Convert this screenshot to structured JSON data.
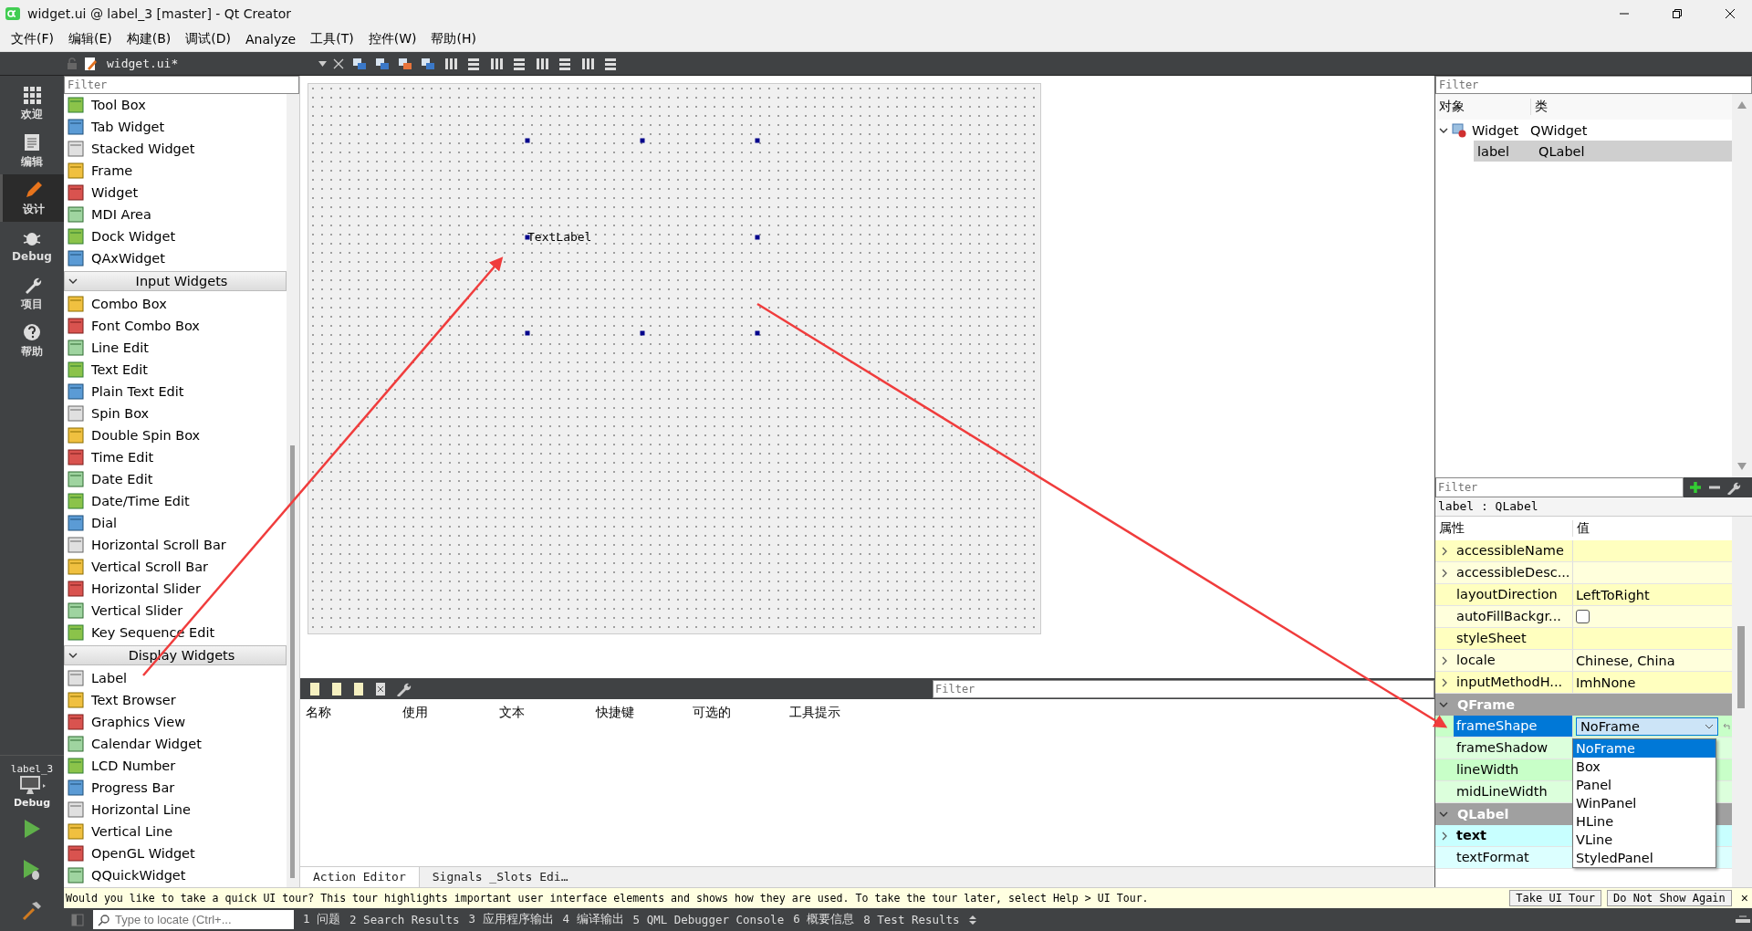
{
  "window": {
    "title": "widget.ui @ label_3 [master] - Qt Creator"
  },
  "menu": [
    "文件(F)",
    "编辑(E)",
    "构建(B)",
    "调试(D)",
    "Analyze",
    "工具(T)",
    "控件(W)",
    "帮助(H)"
  ],
  "editor_toolbar": {
    "document": "widget.ui*"
  },
  "mode_bar": [
    {
      "label": "欢迎",
      "kind": "welcome",
      "selected": false
    },
    {
      "label": "编辑",
      "kind": "edit",
      "selected": false
    },
    {
      "label": "设计",
      "kind": "design",
      "selected": true
    },
    {
      "label": "Debug",
      "kind": "debug",
      "selected": false
    },
    {
      "label": "项目",
      "kind": "projects",
      "selected": false
    },
    {
      "label": "帮助",
      "kind": "help",
      "selected": false
    }
  ],
  "kit_selector": {
    "project": "label_3",
    "build": "Debug"
  },
  "widget_box": {
    "placeholder": "Filter",
    "entries": [
      {
        "kind": "item",
        "label": "Tool Box"
      },
      {
        "kind": "item",
        "label": "Tab Widget"
      },
      {
        "kind": "item",
        "label": "Stacked Widget"
      },
      {
        "kind": "item",
        "label": "Frame"
      },
      {
        "kind": "item",
        "label": "Widget"
      },
      {
        "kind": "item",
        "label": "MDI Area"
      },
      {
        "kind": "item",
        "label": "Dock Widget"
      },
      {
        "kind": "item",
        "label": "QAxWidget"
      },
      {
        "kind": "category",
        "label": "Input Widgets",
        "expanded": true
      },
      {
        "kind": "item",
        "label": "Combo Box"
      },
      {
        "kind": "item",
        "label": "Font Combo Box"
      },
      {
        "kind": "item",
        "label": "Line Edit"
      },
      {
        "kind": "item",
        "label": "Text Edit"
      },
      {
        "kind": "item",
        "label": "Plain Text Edit"
      },
      {
        "kind": "item",
        "label": "Spin Box"
      },
      {
        "kind": "item",
        "label": "Double Spin Box"
      },
      {
        "kind": "item",
        "label": "Time Edit"
      },
      {
        "kind": "item",
        "label": "Date Edit"
      },
      {
        "kind": "item",
        "label": "Date/Time Edit"
      },
      {
        "kind": "item",
        "label": "Dial"
      },
      {
        "kind": "item",
        "label": "Horizontal Scroll Bar"
      },
      {
        "kind": "item",
        "label": "Vertical Scroll Bar"
      },
      {
        "kind": "item",
        "label": "Horizontal Slider"
      },
      {
        "kind": "item",
        "label": "Vertical Slider"
      },
      {
        "kind": "item",
        "label": "Key Sequence Edit"
      },
      {
        "kind": "category",
        "label": "Display Widgets",
        "expanded": true
      },
      {
        "kind": "item",
        "label": "Label"
      },
      {
        "kind": "item",
        "label": "Text Browser"
      },
      {
        "kind": "item",
        "label": "Graphics View"
      },
      {
        "kind": "item",
        "label": "Calendar Widget"
      },
      {
        "kind": "item",
        "label": "LCD Number"
      },
      {
        "kind": "item",
        "label": "Progress Bar"
      },
      {
        "kind": "item",
        "label": "Horizontal Line"
      },
      {
        "kind": "item",
        "label": "Vertical Line"
      },
      {
        "kind": "item",
        "label": "OpenGL Widget"
      },
      {
        "kind": "item",
        "label": "QQuickWidget"
      }
    ]
  },
  "form": {
    "label": {
      "text": "TextLabel",
      "selected": true
    }
  },
  "action_editor": {
    "placeholder": "Filter",
    "columns": [
      "名称",
      "使用",
      "文本",
      "快捷键",
      "可选的",
      "工具提示"
    ],
    "tabs": [
      {
        "label": "Action Editor",
        "selected": true
      },
      {
        "label": "Signals _Slots Edi…",
        "selected": false
      }
    ]
  },
  "object_inspector": {
    "placeholder": "Filter",
    "columns": [
      "对象",
      "类"
    ],
    "rows": [
      {
        "object": "Widget",
        "class": "QWidget",
        "expanded": true,
        "selected": false,
        "children": [
          {
            "object": "label",
            "class": "QLabel",
            "selected": true
          }
        ]
      }
    ]
  },
  "property_editor": {
    "placeholder": "Filter",
    "object_label": "label : QLabel",
    "columns": [
      "属性",
      "值"
    ],
    "rows": [
      {
        "kind": "property",
        "name": "accessibleName",
        "value": "",
        "expandable": true,
        "modified": false,
        "selected": false,
        "color": "#ffffbf"
      },
      {
        "kind": "property",
        "name": "accessibleDesc...",
        "value": "",
        "expandable": true,
        "modified": false,
        "selected": false,
        "color": "#ffffdc"
      },
      {
        "kind": "property",
        "name": "layoutDirection",
        "value": "LeftToRight",
        "expandable": false,
        "modified": false,
        "selected": false,
        "color": "#ffffbf"
      },
      {
        "kind": "check",
        "name": "autoFillBackgr...",
        "checked": false,
        "expandable": false,
        "modified": false,
        "selected": false,
        "color": "#ffffdc"
      },
      {
        "kind": "property",
        "name": "styleSheet",
        "value": "",
        "expandable": false,
        "modified": false,
        "selected": false,
        "color": "#ffffbf"
      },
      {
        "kind": "property",
        "name": "locale",
        "value": "Chinese, China",
        "expandable": true,
        "modified": false,
        "selected": false,
        "color": "#ffffdc"
      },
      {
        "kind": "property",
        "name": "inputMethodH...",
        "value": "ImhNone",
        "expandable": true,
        "modified": false,
        "selected": false,
        "color": "#ffffbf"
      },
      {
        "kind": "group",
        "name": "QFrame",
        "expanded": true
      },
      {
        "kind": "combo",
        "name": "frameShape",
        "value": "NoFrame",
        "expandable": false,
        "modified": false,
        "selected": true,
        "color": "#c8ffc8"
      },
      {
        "kind": "property",
        "name": "frameShadow",
        "value": "",
        "expandable": false,
        "modified": false,
        "selected": false,
        "color": "#dcffdc"
      },
      {
        "kind": "property",
        "name": "lineWidth",
        "value": "",
        "expandable": false,
        "modified": false,
        "selected": false,
        "color": "#c8ffc8"
      },
      {
        "kind": "property",
        "name": "midLineWidth",
        "value": "",
        "expandable": false,
        "modified": false,
        "selected": false,
        "color": "#dcffdc"
      },
      {
        "kind": "group",
        "name": "QLabel",
        "expanded": true
      },
      {
        "kind": "property",
        "name": "text",
        "value": "",
        "expandable": true,
        "modified": true,
        "selected": false,
        "color": "#c8ffff"
      },
      {
        "kind": "property",
        "name": "textFormat",
        "value": "",
        "expandable": false,
        "modified": false,
        "selected": false,
        "color": "#dcffff"
      }
    ],
    "dropdown": {
      "options": [
        {
          "label": "NoFrame",
          "selected": true
        },
        {
          "label": "Box",
          "selected": false
        },
        {
          "label": "Panel",
          "selected": false
        },
        {
          "label": "WinPanel",
          "selected": false
        },
        {
          "label": "HLine",
          "selected": false
        },
        {
          "label": "VLine",
          "selected": false
        },
        {
          "label": "StyledPanel",
          "selected": false
        }
      ]
    }
  },
  "tour_bar": {
    "message": "Would you like to take a quick UI tour? This tour highlights important user interface elements and shows how they are used. To take the tour later, select Help > UI Tour.",
    "buttons": [
      "Take UI Tour",
      "Do Not Show Again"
    ],
    "close": "×"
  },
  "status_bar": {
    "locator_placeholder": "Type to locate (Ctrl+...",
    "panes": [
      "1 问题",
      "2 Search Results",
      "3 应用程序输出",
      "4 编译输出",
      "5 QML Debugger Console",
      "6 概要信息",
      "8 Test Results"
    ]
  }
}
